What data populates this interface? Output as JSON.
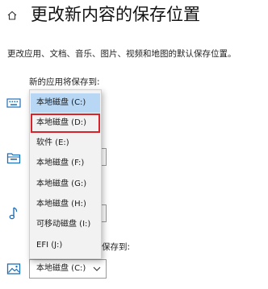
{
  "header": {
    "title": "更改新内容的保存位置"
  },
  "description": "更改应用、文档、音乐、图片、视频和地图的默认保存位置。",
  "sections": {
    "apps_label": "新的应用将保存到:",
    "maps_label_partial": "保存到:"
  },
  "dropdown": {
    "items": [
      {
        "label": "本地磁盘 (C:)",
        "state": "selected"
      },
      {
        "label": "本地磁盘 (D:)",
        "state": "marked"
      },
      {
        "label": "软件 (E:)"
      },
      {
        "label": "本地磁盘 (F:)"
      },
      {
        "label": "本地磁盘 (G:)"
      },
      {
        "label": "本地磁盘 (H:)"
      },
      {
        "label": "可移动磁盘 (I:)"
      },
      {
        "label": "EFI (J:)"
      }
    ]
  },
  "bottom_combo": {
    "value": "本地磁盘 (C:)"
  },
  "colors": {
    "selected_bg": "#b7d7f5",
    "marker": "#d9232b",
    "icon_blue": "#1e6fb8"
  },
  "icons": [
    "home-icon",
    "keyboard-icon",
    "document-folder-icon",
    "music-note-icon",
    "picture-icon",
    "chevron-down-icon"
  ]
}
